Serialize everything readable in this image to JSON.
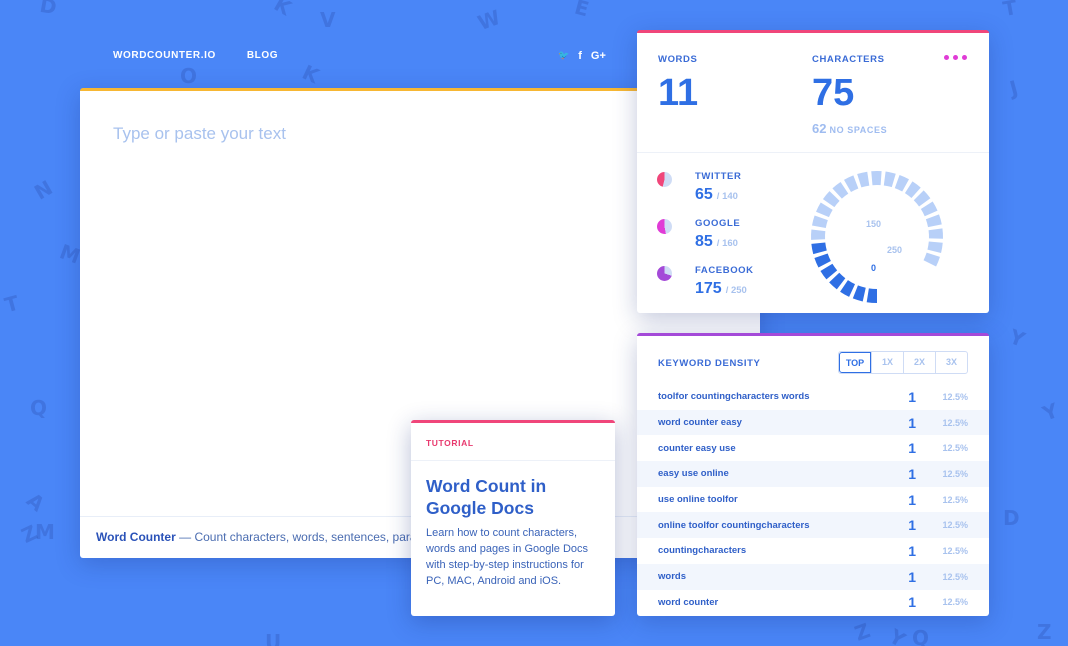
{
  "nav": {
    "brand": "WORDCOUNTER.IO",
    "blog": "BLOG"
  },
  "social_icons": [
    "twitter-icon",
    "facebook-icon",
    "google-plus-icon"
  ],
  "social_glyphs": {
    "twitter": "🐦",
    "facebook": "f",
    "google": "G+"
  },
  "editor": {
    "placeholder": "Type or paste your text",
    "footer_bold": "Word Counter",
    "footer_text": " — Count characters, words, sentences, para"
  },
  "stats": {
    "words_label": "WORDS",
    "words_value": "11",
    "characters_label": "CHARACTERS",
    "characters_value": "75",
    "no_spaces_value": "62",
    "no_spaces_label": "NO SPACES"
  },
  "social_limits": [
    {
      "name": "TWITTER",
      "value": "65",
      "limit": "/ 140",
      "fraction": 0.46,
      "color": "#f0467a"
    },
    {
      "name": "GOOGLE",
      "value": "85",
      "limit": "/ 160",
      "fraction": 0.53,
      "color": "#e03bd6"
    },
    {
      "name": "FACEBOOK",
      "value": "175",
      "limit": "/ 250",
      "fraction": 0.7,
      "color": "#a44ad8"
    }
  ],
  "gauge": {
    "tick_labels": [
      "0",
      "150",
      "250"
    ],
    "filled_fraction": 0.3,
    "fill_color": "#2f6fe4",
    "empty_color": "#b8d0f8"
  },
  "keyword_density": {
    "title": "KEYWORD DENSITY",
    "tabs": [
      "TOP",
      "1X",
      "2X",
      "3X"
    ],
    "rows": [
      {
        "keyword": "toolfor countingcharacters words",
        "count": "1",
        "percent": "12.5%"
      },
      {
        "keyword": "word counter easy",
        "count": "1",
        "percent": "12.5%"
      },
      {
        "keyword": "counter easy use",
        "count": "1",
        "percent": "12.5%"
      },
      {
        "keyword": "easy use online",
        "count": "1",
        "percent": "12.5%"
      },
      {
        "keyword": "use online toolfor",
        "count": "1",
        "percent": "12.5%"
      },
      {
        "keyword": "online toolfor countingcharacters",
        "count": "1",
        "percent": "12.5%"
      },
      {
        "keyword": "countingcharacters",
        "count": "1",
        "percent": "12.5%"
      },
      {
        "keyword": "words",
        "count": "1",
        "percent": "12.5%"
      },
      {
        "keyword": "word counter",
        "count": "1",
        "percent": "12.5%"
      }
    ]
  },
  "tutorial": {
    "tag": "TUTORIAL",
    "title": "Word Count in Google Docs",
    "description": "Learn how to count characters, words and pages in Google Docs with step-by-step instructions for PC, MAC, Android and iOS."
  },
  "background_letters": [
    "D",
    "K",
    "W",
    "E",
    "T",
    "O",
    "K",
    "J",
    "N",
    "M",
    "T",
    "Q",
    "Y",
    "A",
    "Z",
    "D",
    "Y",
    "Z",
    "U",
    "Z",
    "Y",
    "Q",
    "V",
    "M"
  ]
}
